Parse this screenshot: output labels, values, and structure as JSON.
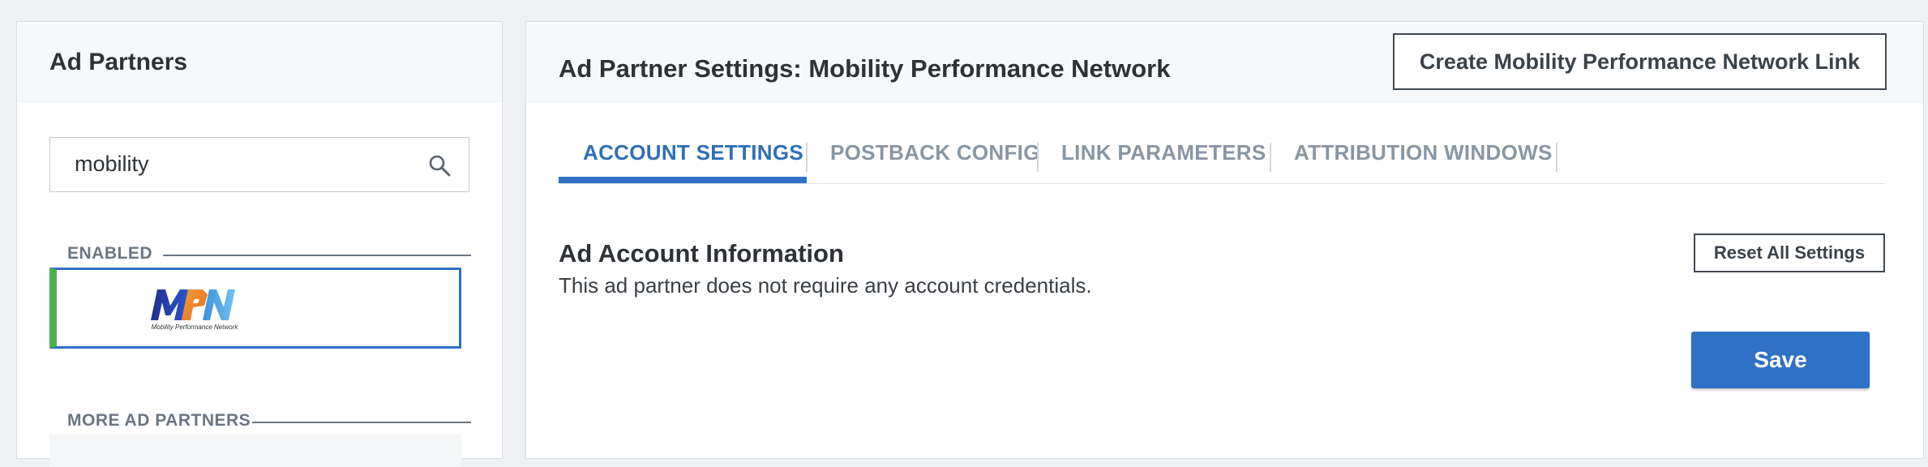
{
  "left_panel": {
    "title": "Ad Partners",
    "search": {
      "value": "mobility",
      "placeholder": "Search"
    },
    "enabled_label": "ENABLED",
    "enabled_partner": {
      "logo_text": "MPN",
      "logo_subtext": "Mobility Performance Network"
    },
    "more_label": "MORE AD PARTNERS"
  },
  "right_panel": {
    "title": "Ad Partner Settings: Mobility Performance Network",
    "create_link_label": "Create Mobility Performance Network Link",
    "tabs": [
      {
        "label": "ACCOUNT SETTINGS",
        "active": true
      },
      {
        "label": "POSTBACK CONFIG",
        "active": false
      },
      {
        "label": "LINK PARAMETERS",
        "active": false
      },
      {
        "label": "ATTRIBUTION WINDOWS",
        "active": false
      }
    ],
    "section_title": "Ad Account Information",
    "section_desc": "This ad partner does not require any account credentials.",
    "reset_label": "Reset All Settings",
    "save_label": "Save"
  },
  "colors": {
    "accent": "#2f71c4",
    "enabled_marker": "#4caf50",
    "tab_inactive": "#8895a3"
  }
}
